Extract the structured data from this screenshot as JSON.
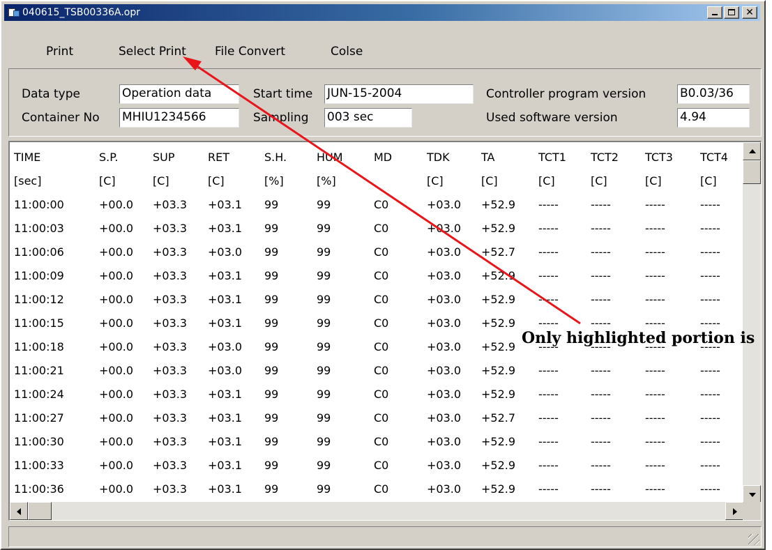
{
  "window": {
    "title": "040615_TSB00336A.opr",
    "icon": "document-icon",
    "buttons": [
      "minimize-icon",
      "maximize-icon",
      "close-icon"
    ]
  },
  "menu": [
    {
      "label": "Print"
    },
    {
      "label": "Select Print"
    },
    {
      "label": "File Convert"
    },
    {
      "label": "Colse"
    }
  ],
  "info": {
    "data_type_label": "Data type",
    "data_type_value": "Operation data",
    "container_label": "Container No",
    "container_value": "MHIU1234566",
    "start_time_label": "Start time",
    "start_time_value": "JUN-15-2004",
    "sampling_label": "Sampling",
    "sampling_value": "003 sec",
    "controller_label": "Controller program version",
    "controller_value": "B0.03/36",
    "software_label": "Used software version",
    "software_value": "4.94"
  },
  "table": {
    "headers": [
      "TIME",
      "S.P.",
      "SUP",
      "RET",
      "S.H.",
      "HUM",
      "MD",
      "TDK",
      "TA",
      "TCT1",
      "TCT2",
      "TCT3",
      "TCT4"
    ],
    "units": [
      "[sec]",
      "[C]",
      "[C]",
      "[C]",
      "[%]",
      "[%]",
      "",
      "[C]",
      "[C]",
      "[C]",
      "[C]",
      "[C]",
      "[C]"
    ],
    "rows": [
      [
        "11:00:00",
        "+00.0",
        "+03.3",
        "+03.1",
        "99",
        "99",
        "C0",
        "+03.0",
        "+52.9",
        "-----",
        "-----",
        "-----",
        "-----"
      ],
      [
        "11:00:03",
        "+00.0",
        "+03.3",
        "+03.1",
        "99",
        "99",
        "C0",
        "+03.0",
        "+52.9",
        "-----",
        "-----",
        "-----",
        "-----"
      ],
      [
        "11:00:06",
        "+00.0",
        "+03.3",
        "+03.0",
        "99",
        "99",
        "C0",
        "+03.0",
        "+52.7",
        "-----",
        "-----",
        "-----",
        "-----"
      ],
      [
        "11:00:09",
        "+00.0",
        "+03.3",
        "+03.1",
        "99",
        "99",
        "C0",
        "+03.0",
        "+52.9",
        "-----",
        "-----",
        "-----",
        "-----"
      ],
      [
        "11:00:12",
        "+00.0",
        "+03.3",
        "+03.1",
        "99",
        "99",
        "C0",
        "+03.0",
        "+52.9",
        "-----",
        "-----",
        "-----",
        "-----"
      ],
      [
        "11:00:15",
        "+00.0",
        "+03.3",
        "+03.1",
        "99",
        "99",
        "C0",
        "+03.0",
        "+52.9",
        "-----",
        "-----",
        "-----",
        "-----"
      ],
      [
        "11:00:18",
        "+00.0",
        "+03.3",
        "+03.0",
        "99",
        "99",
        "C0",
        "+03.0",
        "+52.9",
        "-----",
        "-----",
        "-----",
        "-----"
      ],
      [
        "11:00:21",
        "+00.0",
        "+03.3",
        "+03.0",
        "99",
        "99",
        "C0",
        "+03.0",
        "+52.9",
        "-----",
        "-----",
        "-----",
        "-----"
      ],
      [
        "11:00:24",
        "+00.0",
        "+03.3",
        "+03.1",
        "99",
        "99",
        "C0",
        "+03.0",
        "+52.9",
        "-----",
        "-----",
        "-----",
        "-----"
      ],
      [
        "11:00:27",
        "+00.0",
        "+03.3",
        "+03.1",
        "99",
        "99",
        "C0",
        "+03.0",
        "+52.7",
        "-----",
        "-----",
        "-----",
        "-----"
      ],
      [
        "11:00:30",
        "+00.0",
        "+03.3",
        "+03.1",
        "99",
        "99",
        "C0",
        "+03.0",
        "+52.9",
        "-----",
        "-----",
        "-----",
        "-----"
      ],
      [
        "11:00:33",
        "+00.0",
        "+03.3",
        "+03.1",
        "99",
        "99",
        "C0",
        "+03.0",
        "+52.9",
        "-----",
        "-----",
        "-----",
        "-----"
      ],
      [
        "11:00:36",
        "+00.0",
        "+03.3",
        "+03.1",
        "99",
        "99",
        "C0",
        "+03.0",
        "+52.9",
        "-----",
        "-----",
        "-----",
        "-----"
      ]
    ]
  },
  "annotation": {
    "text": "Only highlighted portion is",
    "arrow_color": "#e8151b"
  },
  "colors": {
    "titlebar_start": "#0a246a",
    "titlebar_end": "#a6caf0",
    "window_face": "#d4d0c8"
  }
}
